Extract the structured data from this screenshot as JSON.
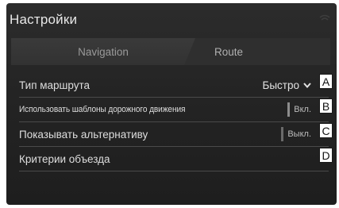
{
  "header": {
    "title": "Настройки",
    "signal_icon": "signal-icon"
  },
  "tabs": [
    {
      "label": "Navigation"
    },
    {
      "label": "Route"
    }
  ],
  "rows": [
    {
      "label": "Тип маршрута",
      "value": "Быстро",
      "icon": "chevron-down-icon"
    },
    {
      "label": "Использовать шаблоны дорожного движения",
      "value": "Вкл."
    },
    {
      "label": "Показывать альтернативу",
      "value": "Выкл."
    },
    {
      "label": "Критерии объезда"
    }
  ],
  "callouts": [
    "A",
    "B",
    "C",
    "D"
  ]
}
